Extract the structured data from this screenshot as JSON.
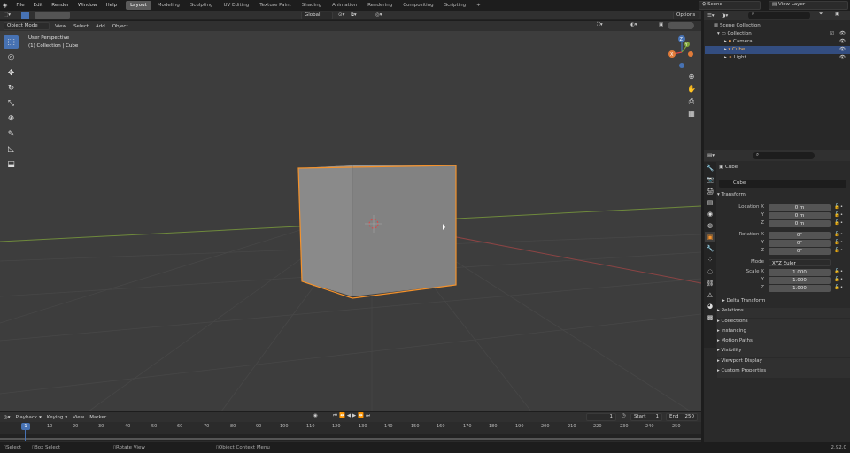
{
  "topbar": {
    "menus": [
      "File",
      "Edit",
      "Render",
      "Window",
      "Help"
    ],
    "workspaces": [
      "Layout",
      "Modeling",
      "Sculpting",
      "UV Editing",
      "Texture Paint",
      "Shading",
      "Animation",
      "Rendering",
      "Compositing",
      "Scripting"
    ],
    "add_tab": "+",
    "scene": "Scene",
    "view_layer": "View Layer"
  },
  "viewport_header": {
    "orientation": "Global",
    "options": "Options"
  },
  "viewport_menu": {
    "mode": "Object Mode",
    "items": [
      "View",
      "Select",
      "Add",
      "Object"
    ]
  },
  "viewport_info": {
    "line1": "User Perspective",
    "line2": "(1) Collection | Cube"
  },
  "gizmo": {
    "z": "Z",
    "x": "X",
    "y": "Y"
  },
  "outliner": {
    "root": "Scene Collection",
    "collection": "Collection",
    "items": [
      "Camera",
      "Cube",
      "Light"
    ]
  },
  "properties": {
    "object_name": "Cube",
    "object_field": "Cube",
    "transform": "Transform",
    "location_label": "Location X",
    "loc": [
      "0 m",
      "0 m",
      "0 m"
    ],
    "rotation_label": "Rotation X",
    "rot": [
      "0°",
      "0°",
      "0°"
    ],
    "mode_label": "Mode",
    "mode_value": "XYZ Euler",
    "scale_label": "Scale X",
    "scale": [
      "1.000",
      "1.000",
      "1.000"
    ],
    "y": "Y",
    "z": "Z",
    "delta": "Delta Transform",
    "panels": [
      "Relations",
      "Collections",
      "Instancing",
      "Motion Paths",
      "Visibility",
      "Viewport Display",
      "Custom Properties"
    ]
  },
  "timeline": {
    "menus": [
      "Playback",
      "Keying",
      "View",
      "Marker"
    ],
    "current_frame": "1",
    "start_label": "Start",
    "start": "1",
    "end_label": "End",
    "end": "250",
    "ticks": [
      "1",
      "10",
      "20",
      "30",
      "40",
      "50",
      "60",
      "70",
      "80",
      "90",
      "100",
      "110",
      "120",
      "130",
      "140",
      "150",
      "160",
      "170",
      "180",
      "190",
      "200",
      "210",
      "220",
      "230",
      "240",
      "250"
    ],
    "playhead": "1"
  },
  "statusbar": {
    "select": "Select",
    "box_select": "Box Select",
    "rotate_view": "Rotate View",
    "context_menu": "Object Context Menu",
    "version": "2.92.0"
  },
  "colors": {
    "accent": "#4772b3",
    "selection": "#f5922b",
    "viewport": "#3d3d3d",
    "x_axis": "#b34848",
    "y_axis": "#7ea33a"
  }
}
